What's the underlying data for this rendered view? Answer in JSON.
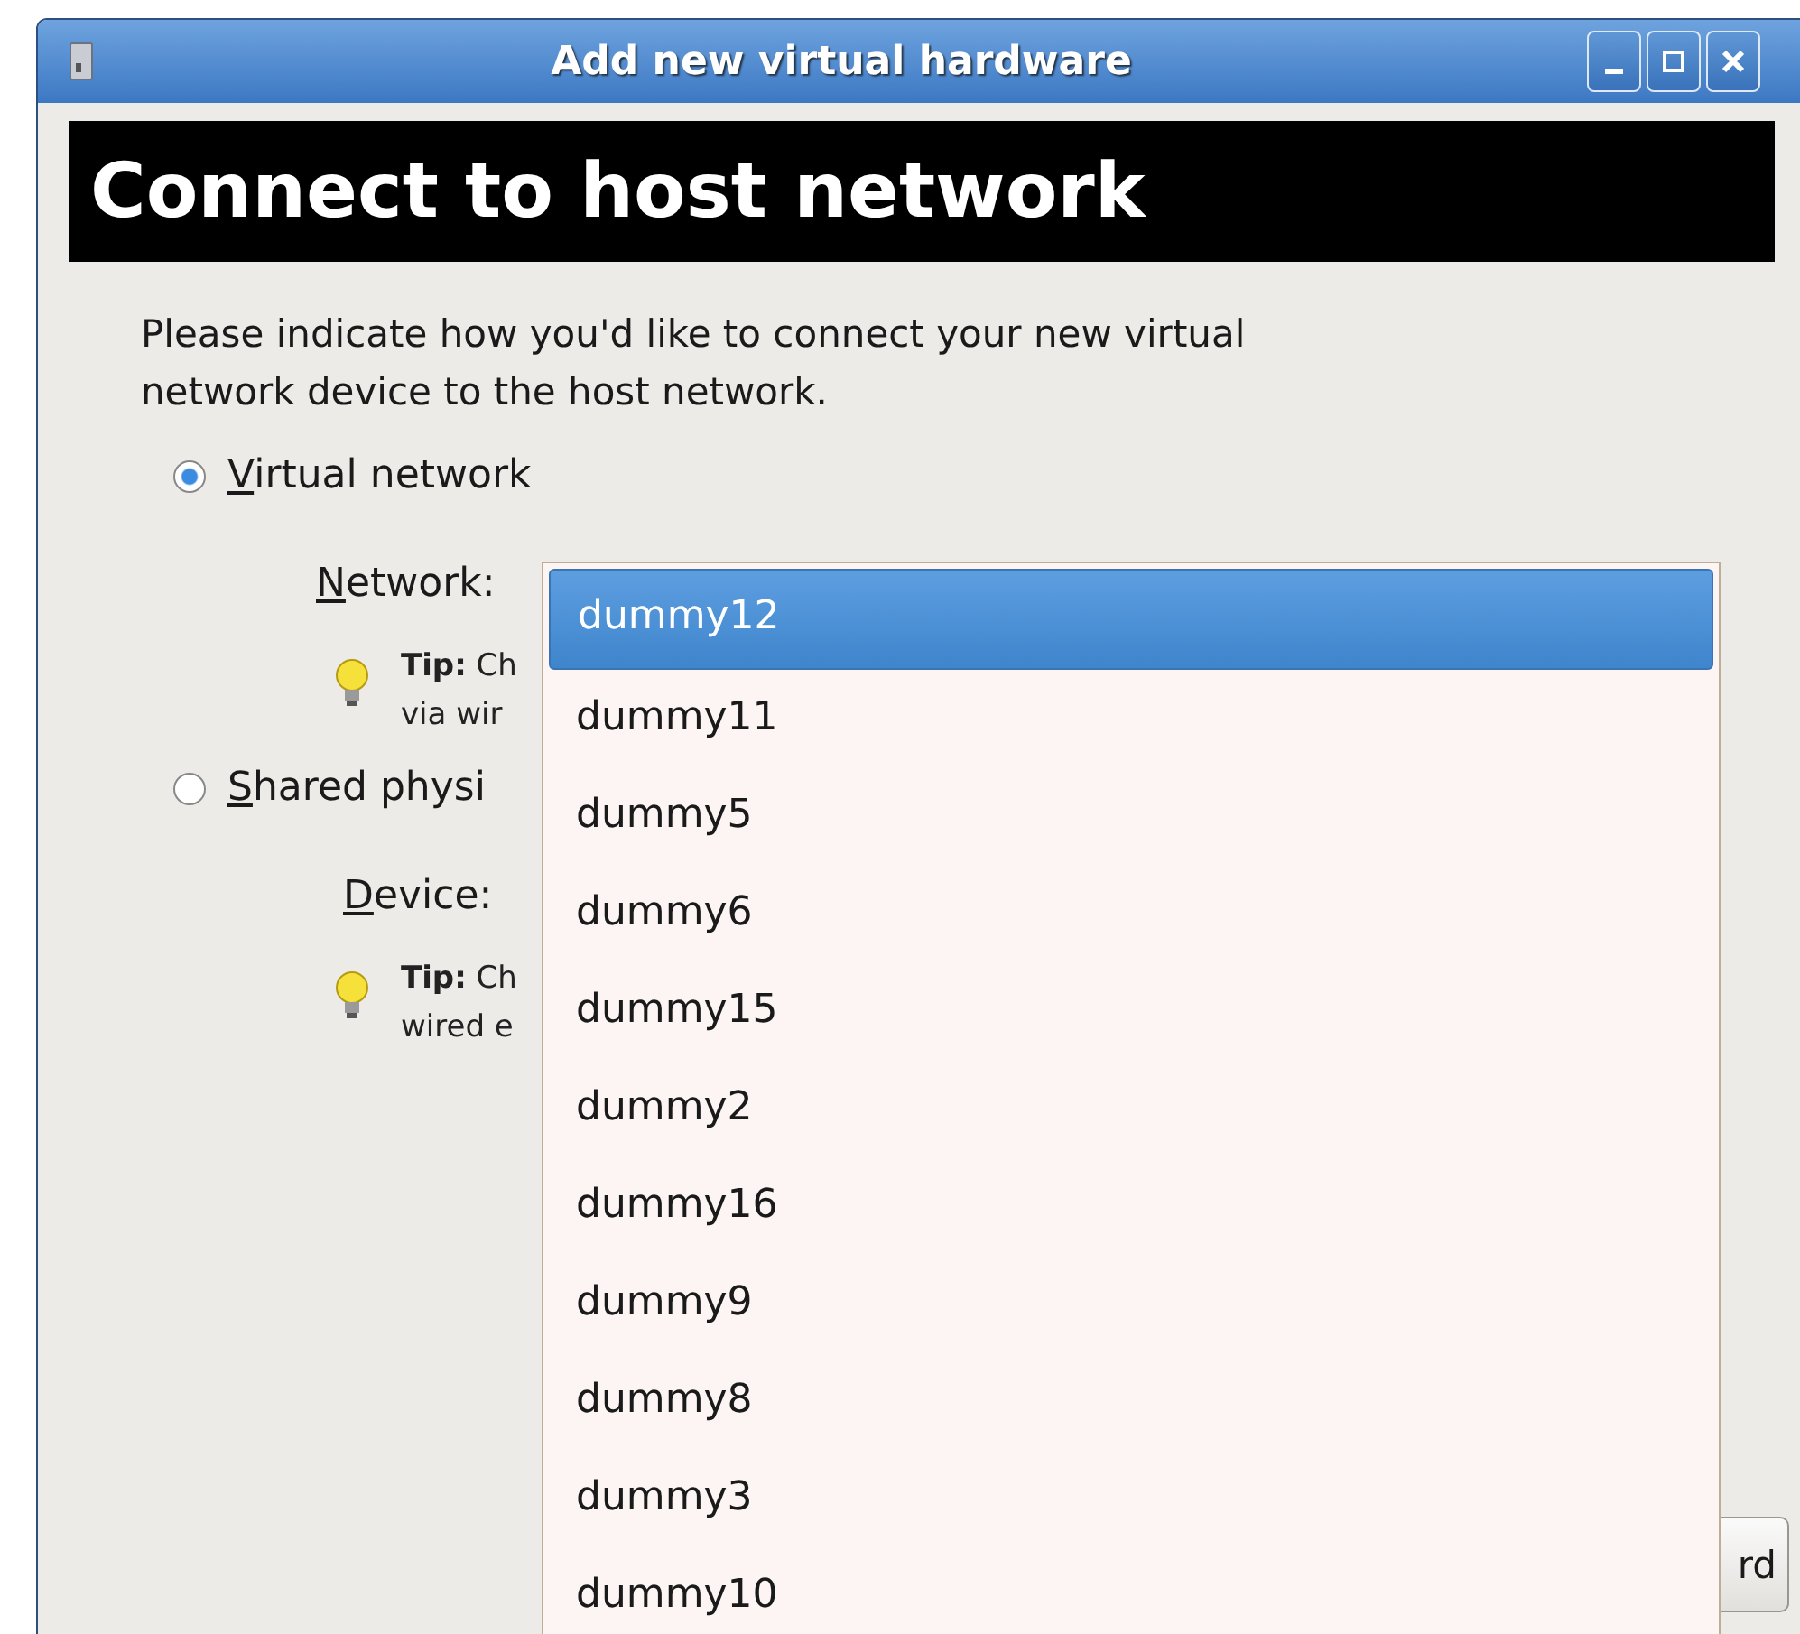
{
  "window": {
    "title": "Add new virtual hardware"
  },
  "heading": "Connect to host network",
  "intro": "Please indicate how you'd like to connect your new virtual network device to the host network.",
  "options": [
    {
      "label": "Virtual network",
      "selected": true,
      "field_label": "Network:",
      "tip_lines": [
        "**Tip:** Ch",
        "via wir"
      ]
    },
    {
      "label": "Shared physi",
      "selected": false,
      "field_label": "Device:",
      "tip_lines": [
        "**Tip:** Ch",
        "wired e"
      ]
    }
  ],
  "dropdown_items": [
    {
      "label": "dummy12",
      "selected": true
    },
    {
      "label": "dummy11",
      "selected": false
    },
    {
      "label": "dummy5",
      "selected": false
    },
    {
      "label": "dummy6",
      "selected": false
    },
    {
      "label": "dummy15",
      "selected": false
    },
    {
      "label": "dummy2",
      "selected": false
    },
    {
      "label": "dummy16",
      "selected": false
    },
    {
      "label": "dummy9",
      "selected": false
    },
    {
      "label": "dummy8",
      "selected": false
    },
    {
      "label": "dummy3",
      "selected": false
    },
    {
      "label": "dummy10",
      "selected": false
    }
  ],
  "button": "rd"
}
